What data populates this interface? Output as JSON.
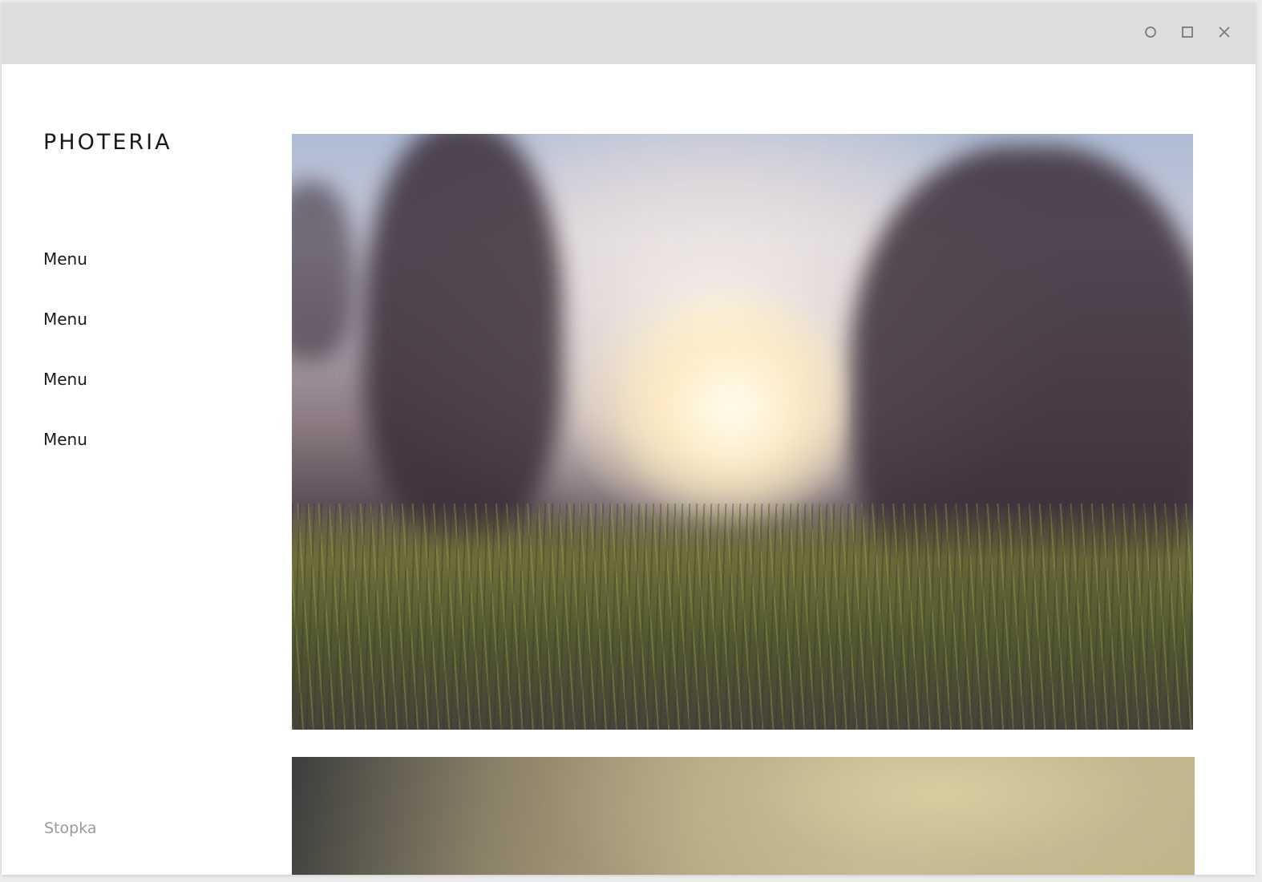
{
  "window": {
    "controls": [
      {
        "name": "minimize",
        "icon": "circle-icon"
      },
      {
        "name": "maximize",
        "icon": "square-icon"
      },
      {
        "name": "close",
        "icon": "close-icon"
      }
    ]
  },
  "brand": {
    "logo": "PHOTERIA"
  },
  "sidebar": {
    "items": [
      {
        "label": "Menu"
      },
      {
        "label": "Menu"
      },
      {
        "label": "Menu"
      },
      {
        "label": "Menu"
      }
    ],
    "footer": "Stopka"
  },
  "gallery": {
    "images": [
      {
        "name": "sunset-grass-photo"
      },
      {
        "name": "blurred-photo"
      }
    ]
  },
  "colors": {
    "titlebar": "#dedede",
    "text": "#1a1a1a",
    "footer_text": "#9a9a9a"
  }
}
